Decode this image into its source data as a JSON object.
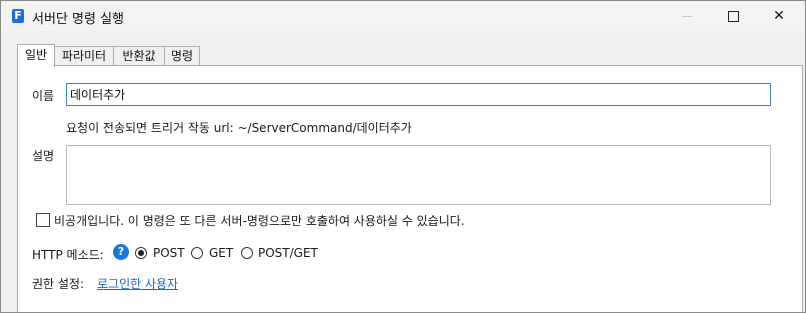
{
  "window": {
    "app_icon_letter": "F",
    "title": "서버단 명령 실행",
    "minimize_glyph": "—",
    "close_glyph": "✕"
  },
  "tabs": [
    {
      "label": "일반",
      "active": true
    },
    {
      "label": "파라미터",
      "active": false
    },
    {
      "label": "반환값",
      "active": false
    },
    {
      "label": "명령",
      "active": false
    }
  ],
  "general": {
    "name_label": "이름",
    "name_value": "데이터추가",
    "url_hint": "요청이 전송되면 트리거 작동 url: ~/ServerCommand/데이터추가",
    "description_label": "설명",
    "description_value": "",
    "private_checkbox_label": "비공개입니다. 이 명령은 또 다른 서버-명령으로만 호출하여 사용하실 수 있습니다.",
    "private_checked": false,
    "http_method_label": "HTTP 메소드:",
    "help_icon_glyph": "?",
    "http_methods": [
      {
        "label": "POST",
        "selected": true
      },
      {
        "label": "GET",
        "selected": false
      },
      {
        "label": "POST/GET",
        "selected": false
      }
    ],
    "permission_label": "권한 설정:",
    "permission_value": "로그인한 사용자"
  },
  "colors": {
    "accent": "#1f6fd8",
    "link": "#1a66c9",
    "input_focus_border": "#3c82c4"
  }
}
